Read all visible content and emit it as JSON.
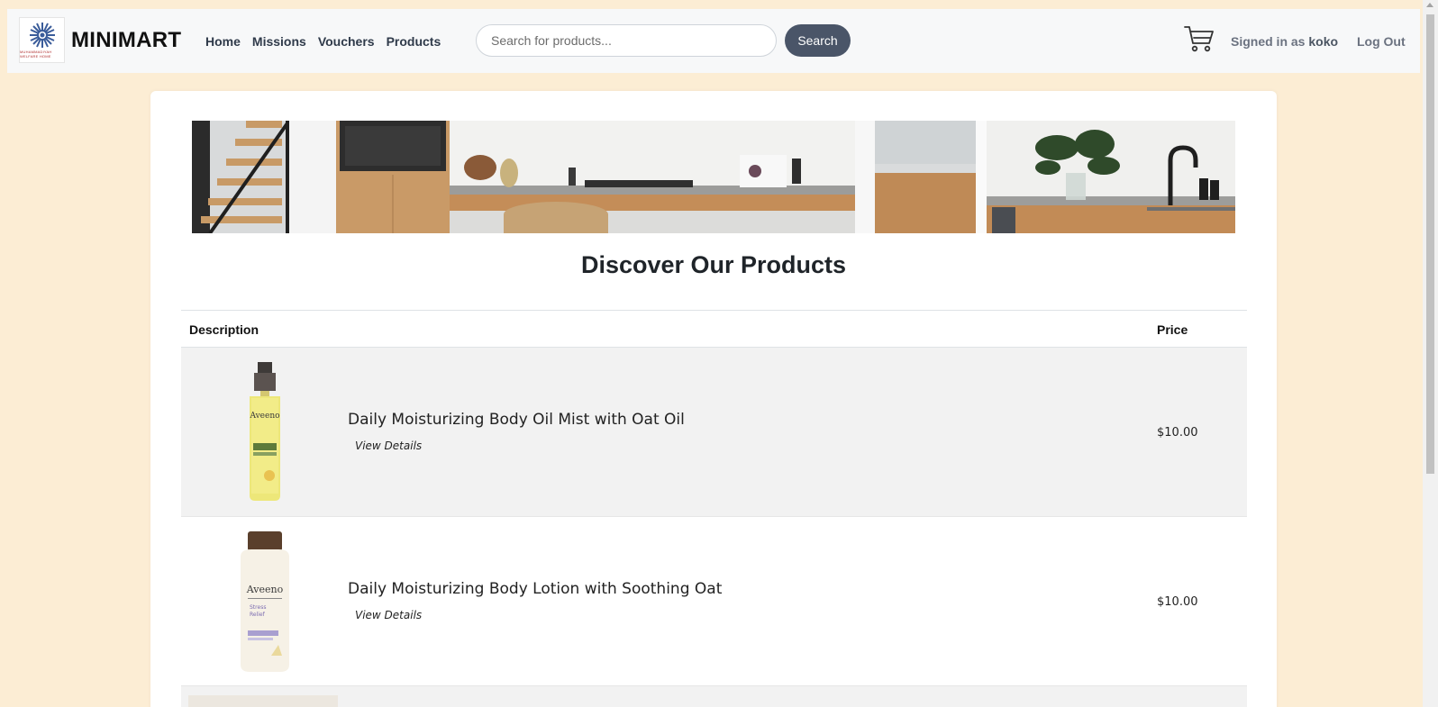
{
  "navbar": {
    "brand": "MINIMART",
    "logo_caption": "MUHAMMADIYAH WELFARE HOME",
    "links": [
      "Home",
      "Missions",
      "Vouchers",
      "Products"
    ],
    "search_placeholder": "Search for products...",
    "search_button": "Search",
    "signed_in_prefix": "Signed in as",
    "username": "koko",
    "logout": "Log Out"
  },
  "page": {
    "heading": "Discover Our Products"
  },
  "table": {
    "columns": [
      "Description",
      "Price"
    ],
    "rows": [
      {
        "name": "Daily Moisturizing Body Oil Mist with Oat Oil",
        "link": "View Details",
        "price": "$10.00",
        "image": "body-oil-mist"
      },
      {
        "name": "Daily Moisturizing Body Lotion with Soothing Oat",
        "link": "View Details",
        "price": "$10.00",
        "image": "body-lotion"
      }
    ]
  },
  "colors": {
    "page_bg": "#fcedd4",
    "navbar_bg": "#f7f8f9",
    "search_button_bg": "#4a5568",
    "row_shade": "#f2f2f2"
  },
  "icons": [
    "logo-emblem",
    "cart-icon"
  ]
}
